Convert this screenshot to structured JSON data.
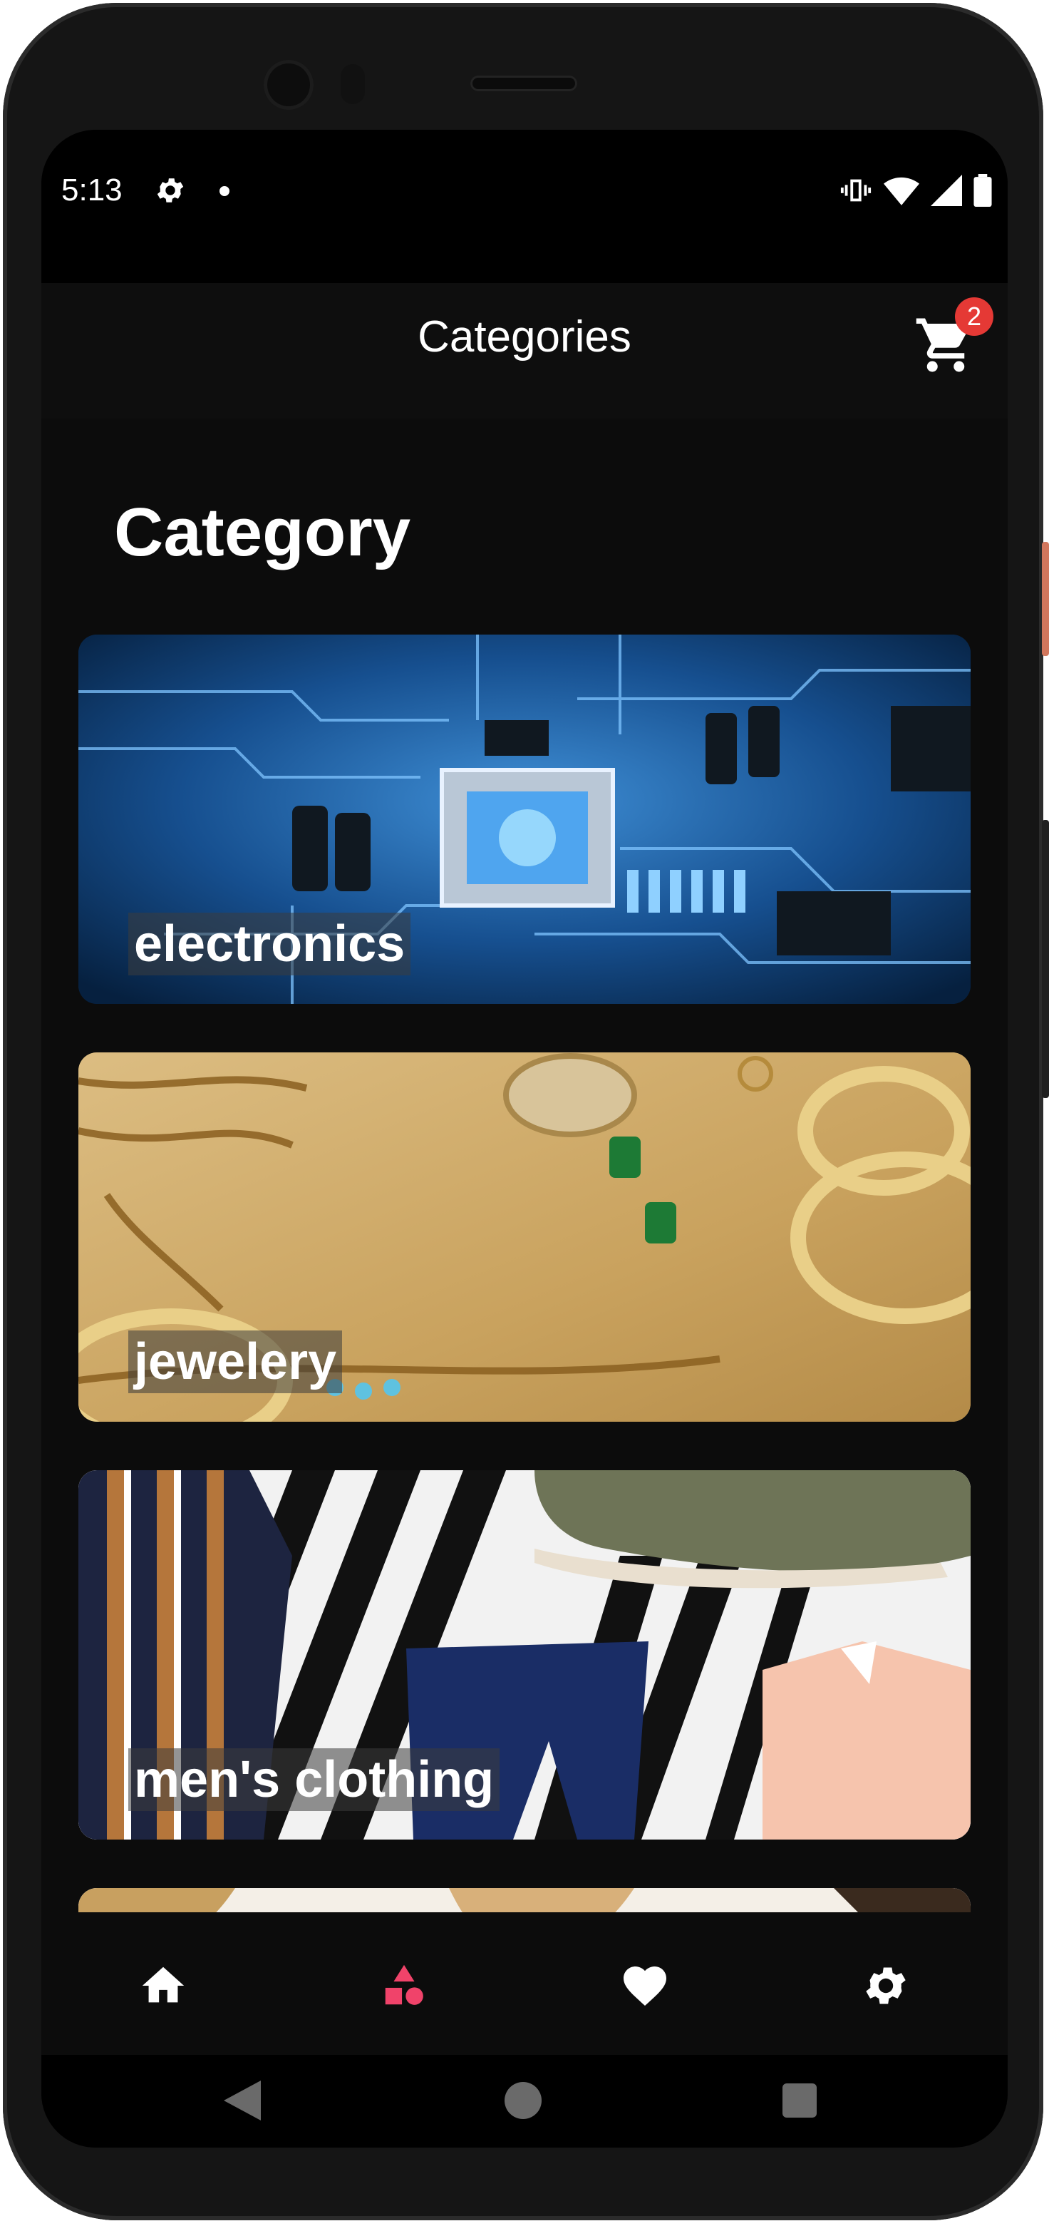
{
  "status_bar": {
    "time": "5:13",
    "icons": [
      "gear-icon",
      "dot-icon",
      "vibrate-icon",
      "wifi-icon",
      "signal-icon",
      "battery-icon"
    ]
  },
  "app_bar": {
    "title": "Categories",
    "cart_badge": "2",
    "cart_icon": "cart-icon"
  },
  "main": {
    "section_heading": "Category",
    "categories": [
      {
        "label": "electronics",
        "image": "circuit-board"
      },
      {
        "label": "jewelery",
        "image": "gold-jewelry"
      },
      {
        "label": "men's clothing",
        "image": "mens-clothing-collage"
      },
      {
        "label": "",
        "image": "womens-clothing-partial"
      }
    ]
  },
  "bottom_nav": {
    "items": [
      {
        "icon": "home-icon",
        "active": false
      },
      {
        "icon": "categories-icon",
        "active": true
      },
      {
        "icon": "heart-icon",
        "active": false
      },
      {
        "icon": "settings-icon",
        "active": false
      }
    ],
    "active_color": "#f0436a",
    "inactive_color": "#ffffff"
  },
  "system_nav": {
    "icons": [
      "back-icon",
      "home-circle-icon",
      "recents-icon"
    ]
  },
  "colors": {
    "background": "#0c0c0c",
    "badge": "#e53935",
    "accent": "#f0436a"
  }
}
